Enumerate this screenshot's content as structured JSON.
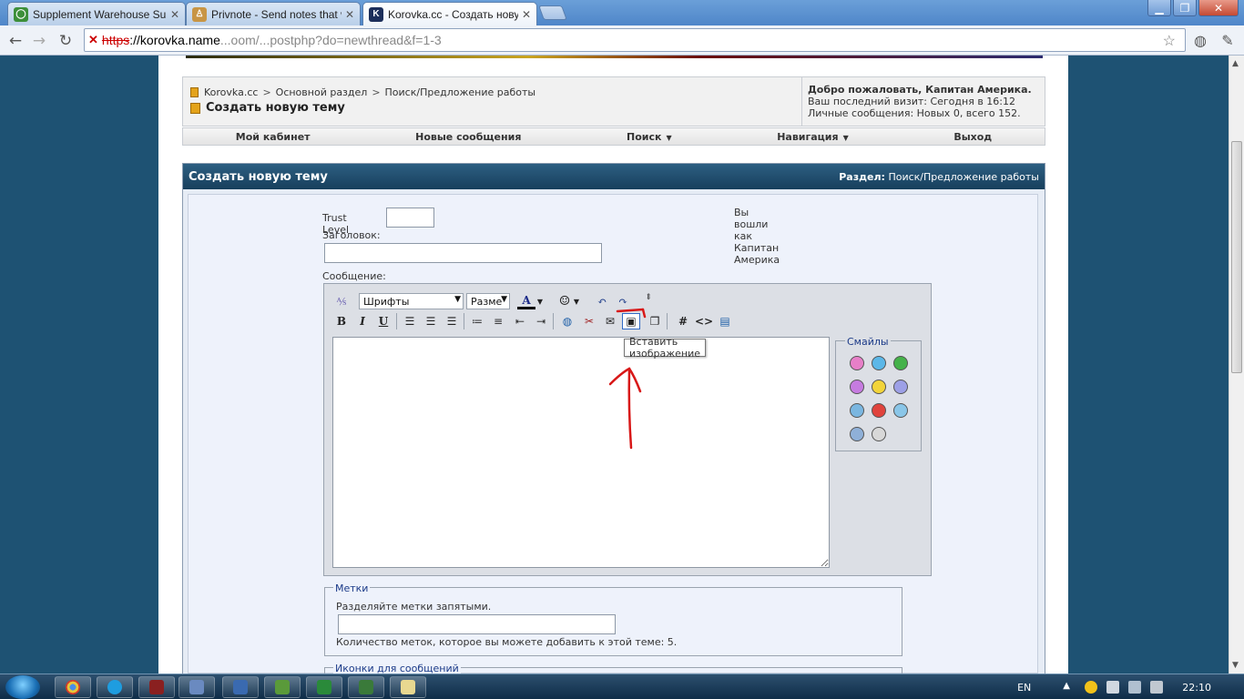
{
  "browser": {
    "tabs": [
      {
        "title": "Supplement Warehouse Sup",
        "fav_color": "#3d8f3a",
        "fav_char": "◯",
        "active": false
      },
      {
        "title": "Privnote - Send notes that w",
        "fav_color": "#c89545",
        "fav_char": "♙",
        "active": false
      },
      {
        "title": "Korovka.cc - Создать новую",
        "fav_color": "#1c2e5a",
        "fav_char": "K",
        "active": true
      }
    ],
    "url_scheme": "https",
    "url_host": "://korovka.name",
    "url_rest": "...oom/...postphp?do=newthread&f=1-3"
  },
  "breadcrumb": {
    "items": [
      "Korovka.cc",
      "Основной раздел",
      "Поиск/Предложение работы"
    ],
    "separator": ">",
    "current": "Создать новую тему"
  },
  "welcome": {
    "title": "Добро пожаловать, Капитан Америка.",
    "last_visit": "Ваш последний визит: Сегодня в 16:12",
    "messages": "Личные сообщения: Новых 0, всего 152."
  },
  "navbar": [
    {
      "label": "Мой кабинет",
      "caret": false
    },
    {
      "label": "Новые сообщения",
      "caret": false
    },
    {
      "label": "Поиск",
      "caret": true
    },
    {
      "label": "Навигация",
      "caret": true
    },
    {
      "label": "Выход",
      "caret": false
    }
  ],
  "panel": {
    "title": "Создать новую тему",
    "section_label": "Раздел:",
    "section_value": "Поиск/Предложение работы"
  },
  "form": {
    "trust_level_label": "Trust Level",
    "trust_level_value": "",
    "title_label": "Заголовок:",
    "title_value": "",
    "message_label": "Сообщение:",
    "logged_in_as": "Вы вошли как Капитан Америка"
  },
  "editor": {
    "font_select": "Шрифты",
    "size_select": "Разме",
    "tooltip": "Вставить изображение",
    "smilies_legend": "Смайлы",
    "smilies": [
      "#e77fc8",
      "#5bb7e8",
      "#45b24a",
      "#c67be0",
      "#f2d43a",
      "#9da0e6",
      "#7ab6e0",
      "#e0433c",
      "#8ac6e8",
      "#8fb0d8",
      "#d8d8d8"
    ]
  },
  "tags": {
    "legend": "Метки",
    "hint": "Разделяйте метки запятыми.",
    "value": "",
    "limit": "Количество меток, которое вы можете добавить к этой теме: 5."
  },
  "msg_icons": {
    "legend": "Иконки для сообщений"
  },
  "taskbar": {
    "lang": "EN",
    "time": "22:10"
  }
}
